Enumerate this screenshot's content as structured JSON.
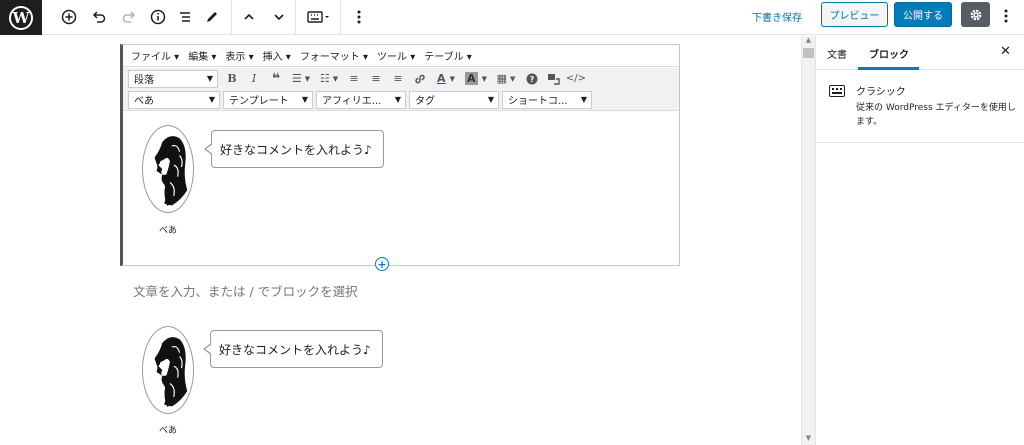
{
  "toolbar": {
    "logo_letter": "W",
    "save_draft": "下書き保存",
    "preview": "プレビュー",
    "publish": "公開する"
  },
  "sidebar": {
    "tabs": [
      "文書",
      "ブロック"
    ],
    "active_tab": "ブロック",
    "block_title": "クラシック",
    "block_desc": "従来の WordPress エディターを使用します。"
  },
  "classic": {
    "menus": [
      "ファイル ▾",
      "編集 ▾",
      "表示 ▾",
      "挿入 ▾",
      "フォーマット ▾",
      "ツール ▾",
      "テーブル ▾"
    ],
    "paragraph_select": "段落",
    "row2_selects": [
      "べあ",
      "テンプレート",
      "アフィリエ...",
      "タグ",
      "ショートコ..."
    ]
  },
  "speech": {
    "text": "好きなコメントを入れよう♪",
    "name": "べあ"
  },
  "placeholder": "文章を入力、または / でブロックを選択",
  "colors": {
    "accent": "#007cba",
    "dark": "#1e1e1e",
    "border": "#e2e4e7"
  }
}
